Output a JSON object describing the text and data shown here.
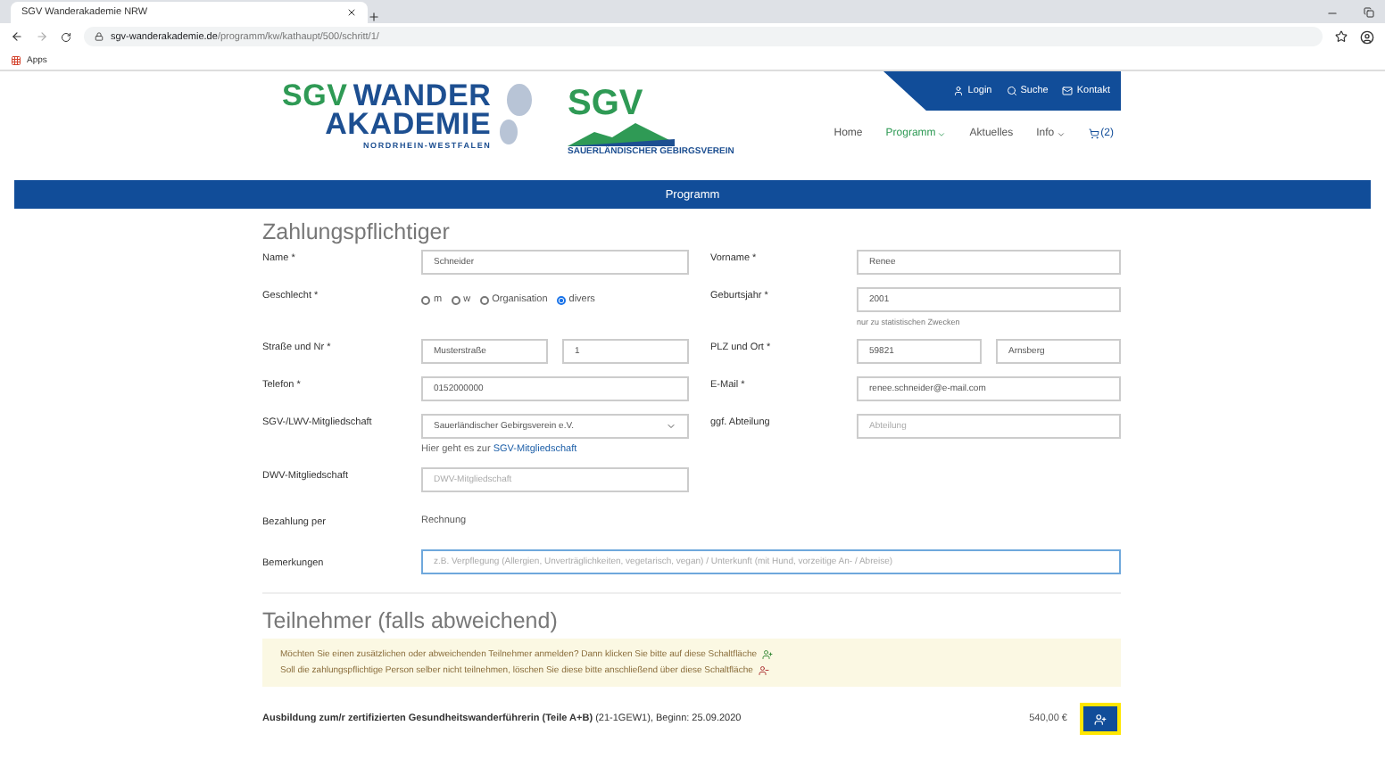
{
  "browser": {
    "tab_title": "SGV Wanderakademie NRW",
    "url_host": "sgv-wanderakademie.de",
    "url_path": "/programm/kw/kathaupt/500/schritt/1/",
    "bookmarks": [
      "Apps"
    ]
  },
  "header": {
    "logo": {
      "first": "SGV",
      "second": "WANDER",
      "third": "AKADEMIE",
      "region": "NORDRHEIN-WESTFALEN"
    },
    "partner_logo": {
      "name": "SGV",
      "subtitle": "SAUERLÄNDISCHER GEBIRGSVEREIN"
    },
    "top_links": [
      {
        "kind": "login",
        "label": "Login"
      },
      {
        "kind": "search",
        "label": "Suche"
      },
      {
        "kind": "mail",
        "label": "Kontakt"
      }
    ],
    "nav": [
      {
        "label": "Home",
        "selected": false,
        "dropdown": false
      },
      {
        "label": "Programm",
        "selected": true,
        "dropdown": true
      },
      {
        "label": "Aktuelles",
        "selected": false,
        "dropdown": false
      },
      {
        "label": "Info",
        "selected": false,
        "dropdown": true
      }
    ],
    "cart": "(2)"
  },
  "banner": "Programm",
  "payer": {
    "title": "Zahlungspflichtiger",
    "rows": [
      {
        "left": {
          "label": "Name *",
          "fields": [
            {
              "kind": "input",
              "value": "Schneider"
            }
          ]
        },
        "right": {
          "label": "Vorname *",
          "fields": [
            {
              "kind": "input",
              "value": "Renee"
            }
          ]
        }
      },
      {
        "left": {
          "label": "Geschlecht *",
          "radios": [
            {
              "label": "m",
              "selected": false
            },
            {
              "label": "w",
              "selected": false
            },
            {
              "label": "Organisation",
              "selected": false
            },
            {
              "label": "divers",
              "selected": true
            }
          ]
        },
        "right": {
          "label": "Geburtsjahr *",
          "fields": [
            {
              "kind": "input",
              "value": "2001"
            }
          ],
          "hint": "nur zu statistischen Zwecken"
        }
      },
      {
        "left": {
          "label": "Straße und Nr *",
          "fields": [
            {
              "kind": "input",
              "value": "Musterstraße"
            },
            {
              "kind": "input",
              "value": "1"
            }
          ]
        },
        "right": {
          "label": "PLZ und Ort *",
          "fields": [
            {
              "kind": "input",
              "value": "59821"
            },
            {
              "kind": "input",
              "value": "Arnsberg"
            }
          ]
        }
      },
      {
        "left": {
          "label": "Telefon *",
          "fields": [
            {
              "kind": "input",
              "value": "0152000000"
            }
          ]
        },
        "right": {
          "label": "E-Mail *",
          "fields": [
            {
              "kind": "input",
              "value": "renee.schneider@e-mail.com"
            }
          ]
        }
      },
      {
        "left": {
          "label": "SGV-/LWV-Mitgliedschaft",
          "fields": [
            {
              "kind": "select",
              "value": "Sauerländischer Gebirgsverein e.V."
            }
          ],
          "hint": "Hier geht es zur",
          "link": "SGV-Mitgliedschaft"
        },
        "right": {
          "label": "ggf. Abteilung",
          "fields": [
            {
              "kind": "input",
              "placeholder": "Abteilung"
            }
          ]
        }
      },
      {
        "left": {
          "label": "DWV-Mitgliedschaft",
          "fields": [
            {
              "kind": "input",
              "placeholder": "DWV-Mitgliedschaft"
            }
          ]
        }
      }
    ],
    "payment": {
      "label": "Bezahlung per",
      "value": "Rechnung"
    },
    "remarks": {
      "label": "Bemerkungen",
      "placeholder": "z.B. Verpflegung (Allergien, Unverträglichkeiten, vegetarisch, vegan) / Unterkunft (mit Hund, vorzeitige An- / Abreise)",
      "focused": true
    }
  },
  "participants": {
    "title": "Teilnehmer (falls abweichend)",
    "notice": [
      {
        "kind": "add",
        "text": "Möchten Sie einen zusätzlichen oder abweichenden Teilnehmer anmelden? Dann klicken Sie bitte auf diese Schaltfläche"
      },
      {
        "kind": "remove",
        "text": "Soll die zahlungspflichtige Person selber nicht teilnehmen, löschen Sie diese bitte anschließend über diese Schaltfläche"
      }
    ],
    "course": {
      "text": "**Ausbildung zum/r zertifizierten Gesundheitswanderführerin (Teile A+B)** (21-1GEW1), Beginn: 25.09.2020",
      "price": "540,00 €",
      "highlighted": true
    }
  }
}
